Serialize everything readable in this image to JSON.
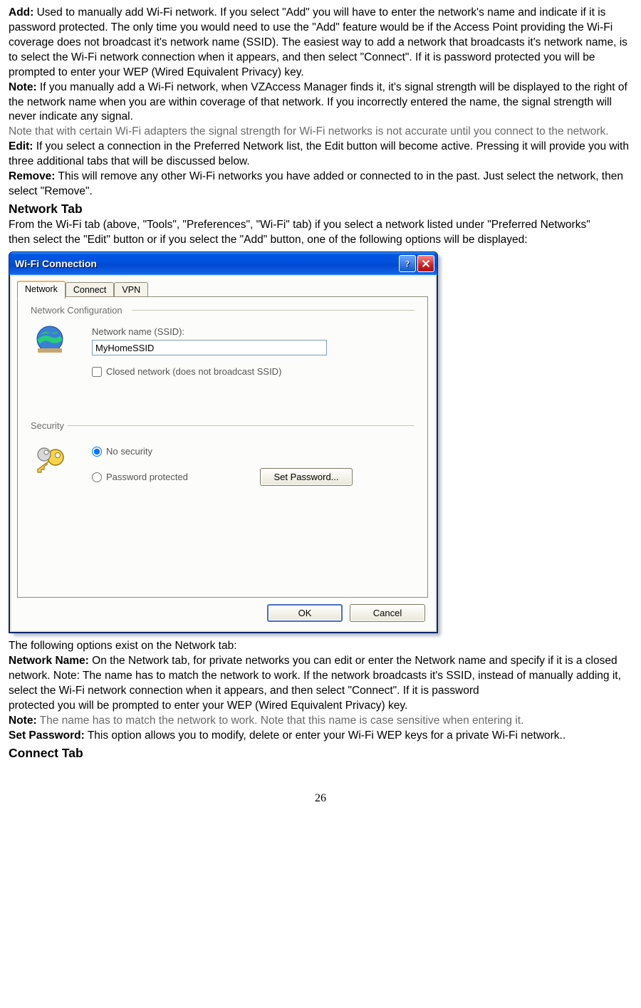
{
  "doc": {
    "add_label": "Add:",
    "add_text": " Used to manually add Wi-Fi network. If you select \"Add\" you will have to enter the network's name and indicate if it is password protected. The only time you would need to use the \"Add\" feature would be if the Access Point providing the Wi-Fi coverage does not broadcast it's network name (SSID). The easiest way to add a network that broadcasts it's network name, is to select the Wi-Fi network connection when it appears, and then select \"Connect\". If it is password protected you will be prompted to enter your WEP (Wired Equivalent Privacy) key.",
    "note1_label": "Note:",
    "note1_text": " If you manually add a Wi-Fi network, when VZAccess Manager finds it, it's signal strength will be displayed to the right of the network name when you are within coverage of that network. If you incorrectly entered the name, the signal strength will never indicate any signal.",
    "gray1": "Note that with certain Wi-Fi adapters the signal strength for Wi-Fi networks is not accurate until you connect to the network.",
    "edit_label": "Edit:",
    "edit_text": " If you select a connection in the Preferred Network list, the Edit button will become active. Pressing it will provide you with three additional tabs that will be discussed below.",
    "remove_label": "Remove:",
    "remove_text": " This will remove any other Wi-Fi networks you have added or connected to in the past. Just select the network, then select \"Remove\".",
    "heading_network_tab": "Network Tab",
    "network_tab_intro1": "From the Wi-Fi tab (above, \"Tools\", \"Preferences\", \"Wi-Fi\" tab) if you select a network listed under \"Preferred Networks\"",
    "network_tab_intro2": "then select the \"Edit\" button or if you select the \"Add\" button, one of the following options will be displayed:",
    "after_dialog_intro": "The following options exist on the Network tab:",
    "netname_label": "Network Name:",
    "netname_text": " On the Network tab, for private networks you can edit or enter the Network name and specify if it is a closed network. Note: The name has to match the network to work. If the network broadcasts it's SSID, instead of manually adding it, select the Wi-Fi network connection when it appears, and then select \"Connect\". If it is password",
    "netname_text2": "protected you will be prompted to enter your WEP (Wired Equivalent Privacy) key.",
    "note2_label": "Note:",
    "note2_gray": " The name has to match the network to work. Note that this name is case sensitive when entering it.",
    "setpwd_label": "Set Password:",
    "setpwd_text": " This option allows you to modify, delete or enter your Wi-Fi WEP keys for a private Wi-Fi network..",
    "heading_connect_tab": "Connect Tab",
    "page_number": "26"
  },
  "dialog": {
    "title": "Wi-Fi Connection",
    "tabs": {
      "network": "Network",
      "connect": "Connect",
      "vpn": "VPN"
    },
    "groupbox1_label": "Network Configuration",
    "ssid_label": "Network name (SSID):",
    "ssid_value": "MyHomeSSID",
    "closed_label": "Closed network (does not broadcast SSID)",
    "groupbox2_label": "Security",
    "radio_nosec": "No security",
    "radio_pwd": "Password protected",
    "btn_set_password": "Set Password...",
    "btn_ok": "OK",
    "btn_cancel": "Cancel"
  }
}
